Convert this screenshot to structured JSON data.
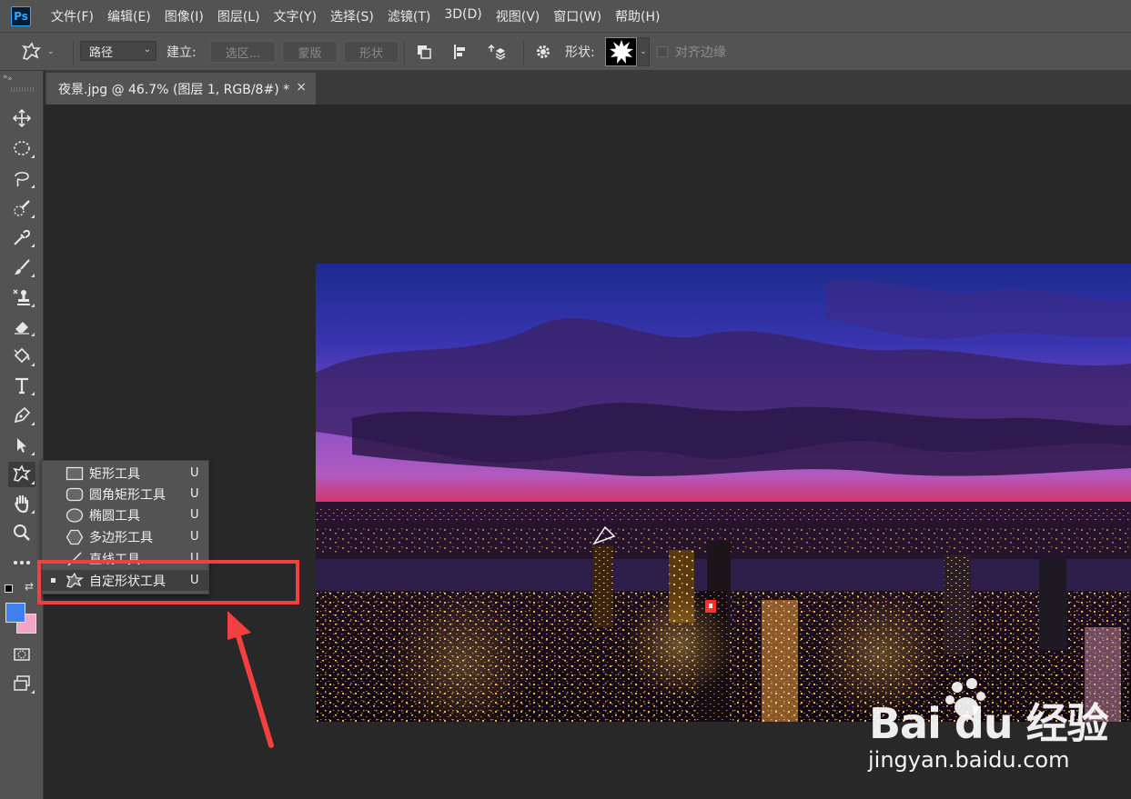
{
  "app": {
    "logo": "Ps"
  },
  "menu": [
    "文件(F)",
    "编辑(E)",
    "图像(I)",
    "图层(L)",
    "文字(Y)",
    "选择(S)",
    "滤镜(T)",
    "3D(D)",
    "视图(V)",
    "窗口(W)",
    "帮助(H)"
  ],
  "options": {
    "mode_value": "路径",
    "make_label": "建立:",
    "selection_btn": "选区...",
    "mask_btn": "蒙版",
    "shape_btn": "形状",
    "shape_label": "形状:",
    "align_edges_label": "对齐边缘"
  },
  "document": {
    "tab_title": "夜景.jpg @ 46.7% (图层 1, RGB/8#) *",
    "close_glyph": "×"
  },
  "flyout": {
    "items": [
      {
        "label": "矩形工具",
        "key": "U",
        "icon": "rectangle-icon"
      },
      {
        "label": "圆角矩形工具",
        "key": "U",
        "icon": "rounded-rectangle-icon"
      },
      {
        "label": "椭圆工具",
        "key": "U",
        "icon": "ellipse-icon"
      },
      {
        "label": "多边形工具",
        "key": "U",
        "icon": "polygon-icon"
      },
      {
        "label": "直线工具",
        "key": "U",
        "icon": "line-icon"
      },
      {
        "label": "自定形状工具",
        "key": "U",
        "icon": "custom-shape-icon",
        "selected": true
      }
    ]
  },
  "colors": {
    "foreground": "#3f7ff0",
    "background": "#f3a4c8",
    "annotation": "#f1403f"
  },
  "watermark": {
    "brand": "Bai du 经验",
    "url": "jingyan.baidu.com"
  }
}
